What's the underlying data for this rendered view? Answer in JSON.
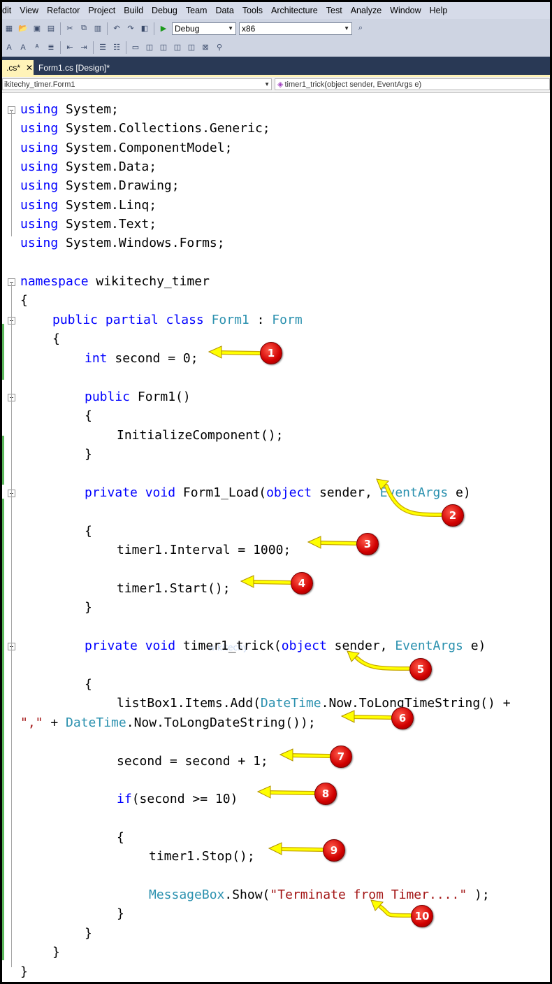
{
  "menu": [
    "Edit",
    "View",
    "Refactor",
    "Project",
    "Build",
    "Debug",
    "Team",
    "Data",
    "Tools",
    "Architecture",
    "Test",
    "Analyze",
    "Window",
    "Help"
  ],
  "menu_visible": [
    "dit",
    "View",
    "Refactor",
    "Project",
    "Build",
    "Debug",
    "Team",
    "Data",
    "Tools",
    "Architecture",
    "Test",
    "Analyze",
    "Window",
    "Help"
  ],
  "toolbar": {
    "config": "Debug",
    "platform": "x86"
  },
  "tabs": [
    {
      "label": ".cs*",
      "active": true,
      "close": "✕"
    },
    {
      "label": "Form1.cs [Design]*",
      "active": false
    }
  ],
  "nav": {
    "type": "ikitechy_timer.Form1",
    "member": "timer1_trick(object sender, EventArgs e)"
  },
  "code_lines": [
    [
      [
        "kw",
        "using"
      ],
      [
        "",
        "System;"
      ]
    ],
    [
      [
        "kw",
        "using"
      ],
      [
        "",
        "System.Collections.Generic;"
      ]
    ],
    [
      [
        "kw",
        "using"
      ],
      [
        "",
        "System.ComponentModel;"
      ]
    ],
    [
      [
        "kw",
        "using"
      ],
      [
        "",
        "System.Data;"
      ]
    ],
    [
      [
        "kw",
        "using"
      ],
      [
        "",
        "System.Drawing;"
      ]
    ],
    [
      [
        "kw",
        "using"
      ],
      [
        "",
        "System.Linq;"
      ]
    ],
    [
      [
        "kw",
        "using"
      ],
      [
        "",
        "System.Text;"
      ]
    ],
    [
      [
        "kw",
        "using"
      ],
      [
        "",
        "System.Windows.Forms;"
      ]
    ],
    [
      [
        "kw",
        "namespace"
      ],
      [
        "",
        "wikitechy_timer"
      ]
    ],
    [
      [
        "",
        "{"
      ]
    ],
    [
      [
        "kw",
        "public partial class"
      ],
      [
        "ty",
        "Form1"
      ],
      [
        "",
        ":"
      ],
      [
        "ty",
        "Form"
      ]
    ],
    [
      [
        "",
        "{"
      ]
    ],
    [
      [
        "kw",
        "int"
      ],
      [
        "",
        "second = 0;"
      ]
    ],
    [
      [
        "kw",
        "public"
      ],
      [
        "",
        "Form1()"
      ]
    ],
    [
      [
        "",
        "{"
      ]
    ],
    [
      [
        "",
        "InitializeComponent();"
      ]
    ],
    [
      [
        "",
        "}"
      ]
    ],
    [
      [
        "kw",
        "private void"
      ],
      [
        "",
        "Form1_Load("
      ],
      [
        "kw",
        "object"
      ],
      [
        "",
        "sender,"
      ],
      [
        "ty",
        "EventArgs"
      ],
      [
        "",
        "e)"
      ]
    ],
    [
      [
        "",
        "{"
      ]
    ],
    [
      [
        "",
        "timer1.Interval = 1000;"
      ]
    ],
    [
      [
        "",
        "timer1.Start();"
      ]
    ],
    [
      [
        "",
        "}"
      ]
    ],
    [
      [
        "kw",
        "private void"
      ],
      [
        "",
        "timer1_trick("
      ],
      [
        "kw",
        "object"
      ],
      [
        "",
        "sender,"
      ],
      [
        "ty",
        "EventArgs"
      ],
      [
        "",
        "e)"
      ]
    ],
    [
      [
        "",
        "{"
      ]
    ],
    [
      [
        "",
        "listBox1.Items.Add("
      ],
      [
        "ty",
        "DateTime"
      ],
      [
        "",
        ".Now.ToLongTimeString() +"
      ]
    ],
    [
      [
        "st",
        "\",\""
      ],
      [
        "",
        "+"
      ],
      [
        "ty",
        "DateTime"
      ],
      [
        "",
        ".Now.ToLongDateString());"
      ]
    ],
    [
      [
        "",
        "second = second + 1;"
      ]
    ],
    [
      [
        "kw",
        "if"
      ],
      [
        "",
        "(second >= 10)"
      ]
    ],
    [
      [
        "",
        "{"
      ]
    ],
    [
      [
        "",
        "timer1.Stop();"
      ]
    ],
    [
      [
        "ty",
        "MessageBox"
      ],
      [
        "",
        ".Show("
      ],
      [
        "st",
        "\"Terminate from Timer....\""
      ],
      [
        "",
        ");"
      ]
    ],
    [
      [
        "",
        "}"
      ]
    ],
    [
      [
        "",
        "}"
      ]
    ],
    [
      [
        "",
        "}"
      ]
    ],
    [
      [
        "",
        "}"
      ]
    ]
  ],
  "annotations": [
    "1",
    "2",
    "3",
    "4",
    "5",
    "6",
    "7",
    "8",
    "9",
    "10"
  ],
  "watermark": "wikitechy",
  "colors": {
    "keyword": "#0000ff",
    "type": "#2b91af",
    "string": "#a31515",
    "arrow": "#ffff00",
    "badge": "#e00000"
  }
}
